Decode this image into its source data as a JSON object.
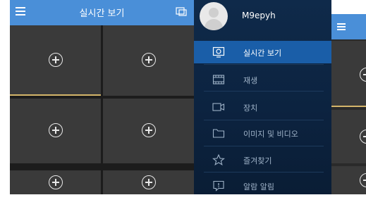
{
  "live_view": {
    "title": "실시간 보기",
    "icons": {
      "menu": "menu-icon",
      "cast": "screen-cast-icon"
    },
    "cells": [
      {
        "state": "add-channel"
      },
      {
        "state": "add-channel"
      },
      {
        "state": "add-channel"
      },
      {
        "state": "add-channel"
      },
      {
        "state": "add-channel"
      },
      {
        "state": "add-channel"
      }
    ]
  },
  "drawer": {
    "username": "M9epyh",
    "items": [
      {
        "label": "실시간 보기",
        "icon": "live-view-icon",
        "active": true
      },
      {
        "label": "재생",
        "icon": "playback-film-icon",
        "active": false
      },
      {
        "label": "장치",
        "icon": "device-icon",
        "active": false
      },
      {
        "label": "이미지 및 비디오",
        "icon": "folder-icon",
        "active": false
      },
      {
        "label": "즐겨찾기",
        "icon": "star-icon",
        "active": false
      },
      {
        "label": "알람 알림",
        "icon": "alarm-message-icon",
        "active": false
      }
    ]
  },
  "colors": {
    "header_blue": "#4a8fd8",
    "drawer_bg": "#0c2340",
    "active_item": "#1a5ea8",
    "selected_border": "#d4b56a"
  }
}
